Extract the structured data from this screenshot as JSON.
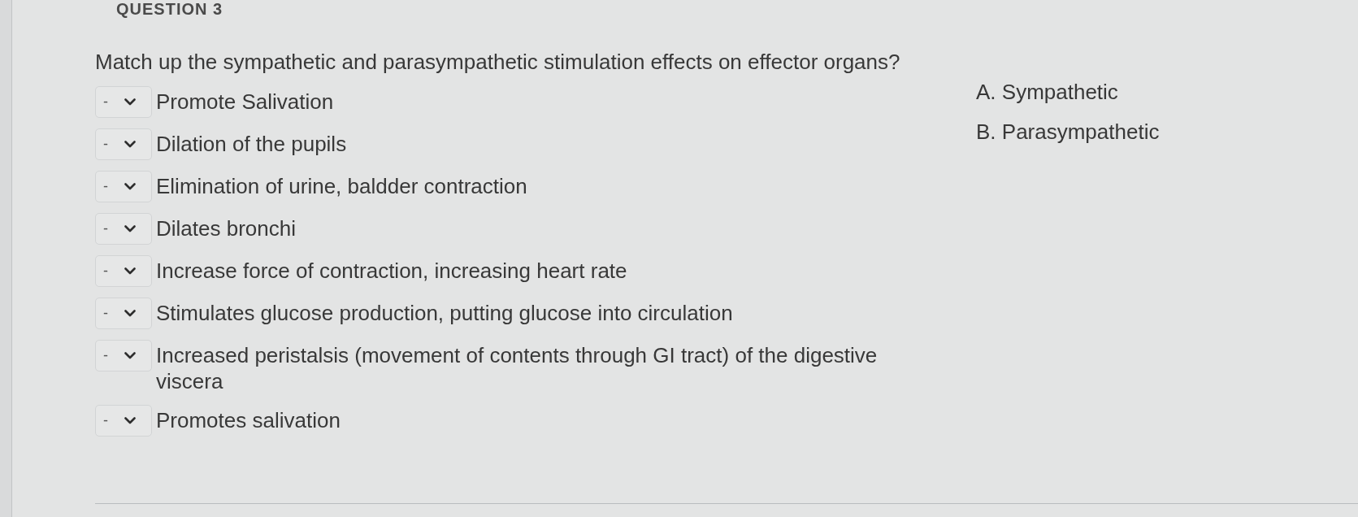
{
  "heading": "QUESTION 3",
  "question": "Match up the sympathetic and parasympathetic stimulation effects on effector organs?",
  "statements": [
    {
      "choice": "-",
      "text": "Promote Salivation"
    },
    {
      "choice": "-",
      "text": "Dilation of the pupils"
    },
    {
      "choice": "-",
      "text": "Elimination of urine, baldder contraction"
    },
    {
      "choice": "-",
      "text": "Dilates bronchi"
    },
    {
      "choice": "-",
      "text": "Increase force of contraction, increasing heart rate"
    },
    {
      "choice": "-",
      "text": "Stimulates glucose production, putting glucose into circulation"
    },
    {
      "choice": "-",
      "text": "Increased peristalsis (movement of contents through GI tract) of the digestive viscera"
    },
    {
      "choice": "-",
      "text": "Promotes salivation"
    }
  ],
  "options": [
    "A. Sympathetic",
    "B. Parasympathetic"
  ]
}
